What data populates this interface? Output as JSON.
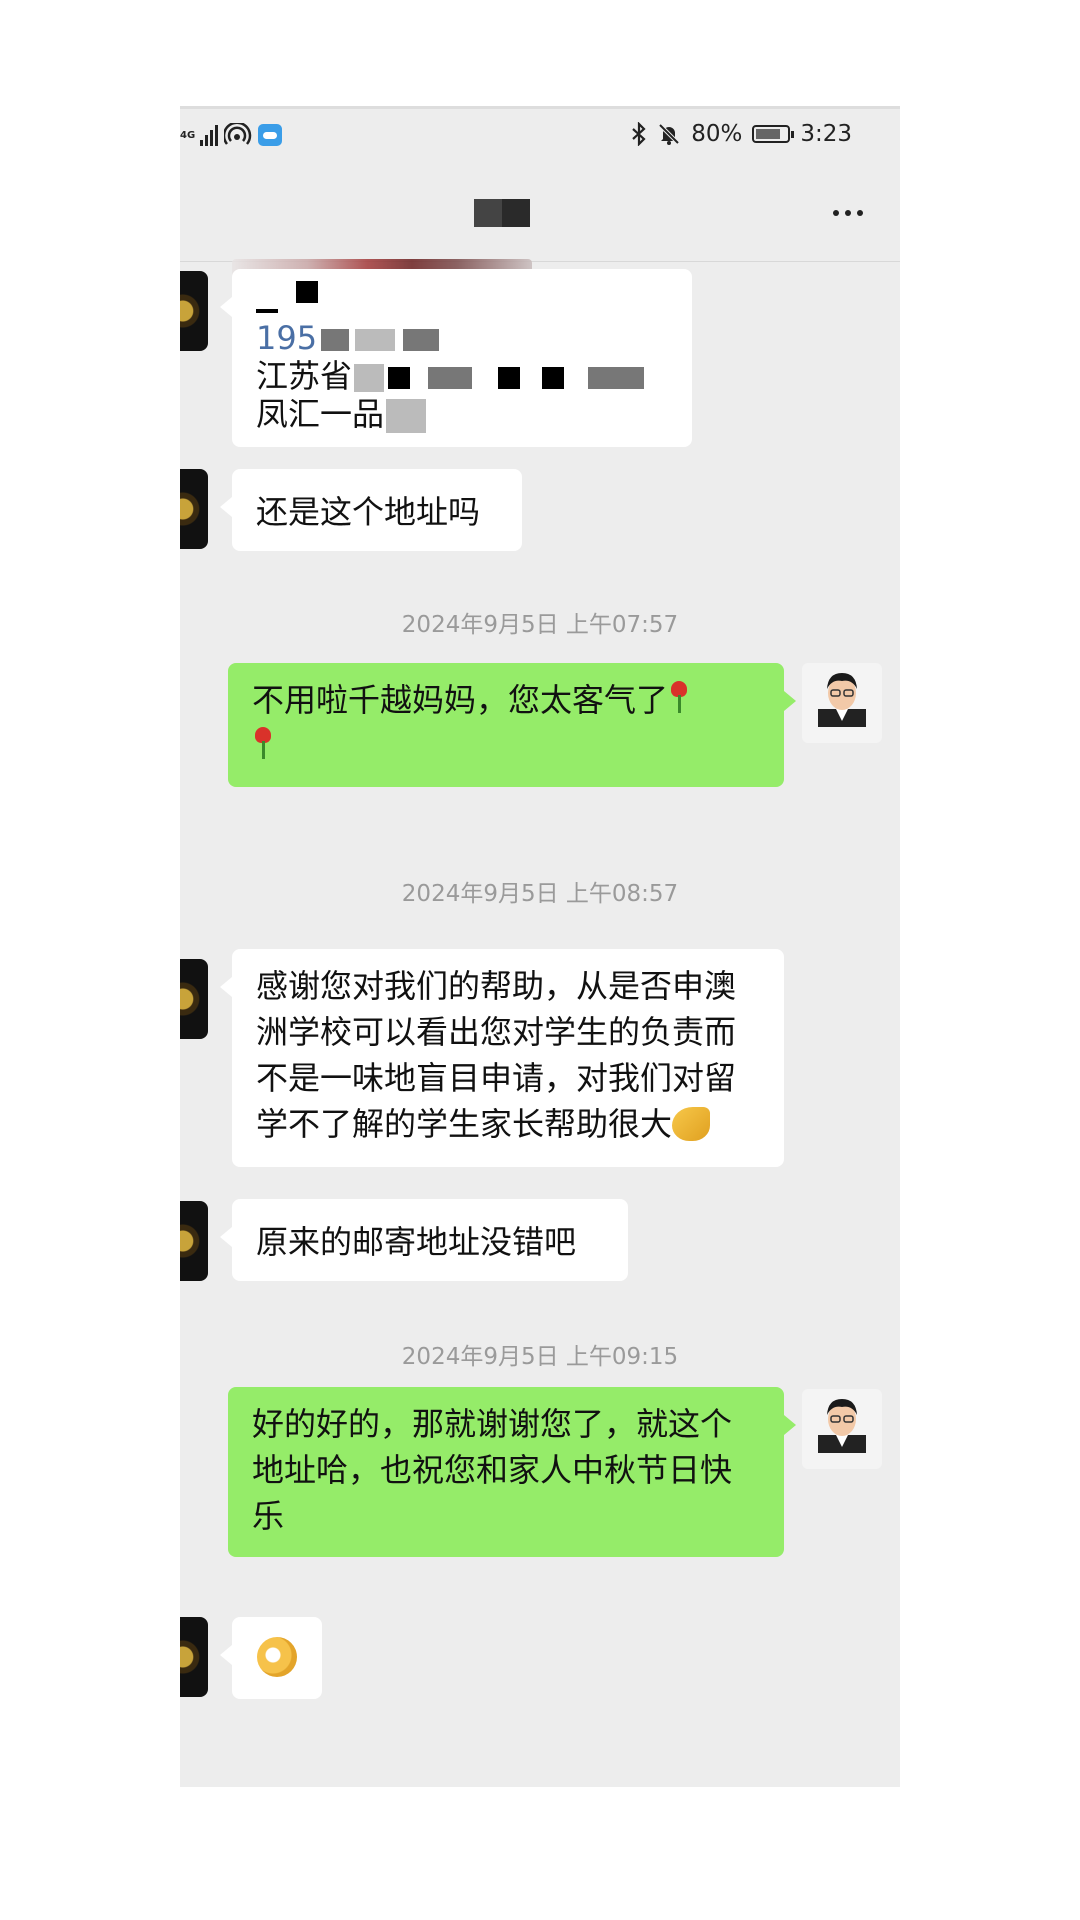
{
  "status_bar": {
    "network": "4G",
    "battery_percent": "80%",
    "battery_level": 0.8,
    "time": "3:23"
  },
  "chat": {
    "title": ""
  },
  "messages": [
    {
      "side": "in",
      "lines": [
        "二\\",
        "195",
        "江苏省",
        "凤汇一品"
      ]
    },
    {
      "side": "in",
      "text": "还是这个地址吗"
    },
    {
      "type": "time",
      "text": "2024年9月5日 上午07:57"
    },
    {
      "side": "out",
      "text": "不用啦千越妈妈，您太客气了"
    },
    {
      "type": "time",
      "text": "2024年9月5日 上午08:57"
    },
    {
      "side": "in",
      "lines": [
        "感谢您对我们的帮助，从是否申澳",
        "洲学校可以看出您对学生的负责而",
        "不是一味地盲目申请，对我们对留",
        "学不了解的学生家长帮助很大"
      ]
    },
    {
      "side": "in",
      "text": "原来的邮寄地址没错吧"
    },
    {
      "type": "time",
      "text": "2024年9月5日 上午09:15"
    },
    {
      "side": "out",
      "lines": [
        "好的好的，那就谢谢您了，就这个",
        "地址哈，也祝您和家人中秋节日快",
        "乐"
      ]
    },
    {
      "side": "in",
      "emoji": "ok-hand"
    }
  ],
  "icons": {
    "bluetooth": "bluetooth-icon",
    "mute": "bell-off-icon",
    "battery": "battery-icon",
    "hotspot": "hotspot-icon",
    "cloud": "cloud-icon",
    "more": "more-icon"
  },
  "colors": {
    "chat_bg": "#ededed",
    "incoming_bubble": "#ffffff",
    "outgoing_bubble": "#95ec69",
    "timestamp": "#9a9a9a"
  }
}
